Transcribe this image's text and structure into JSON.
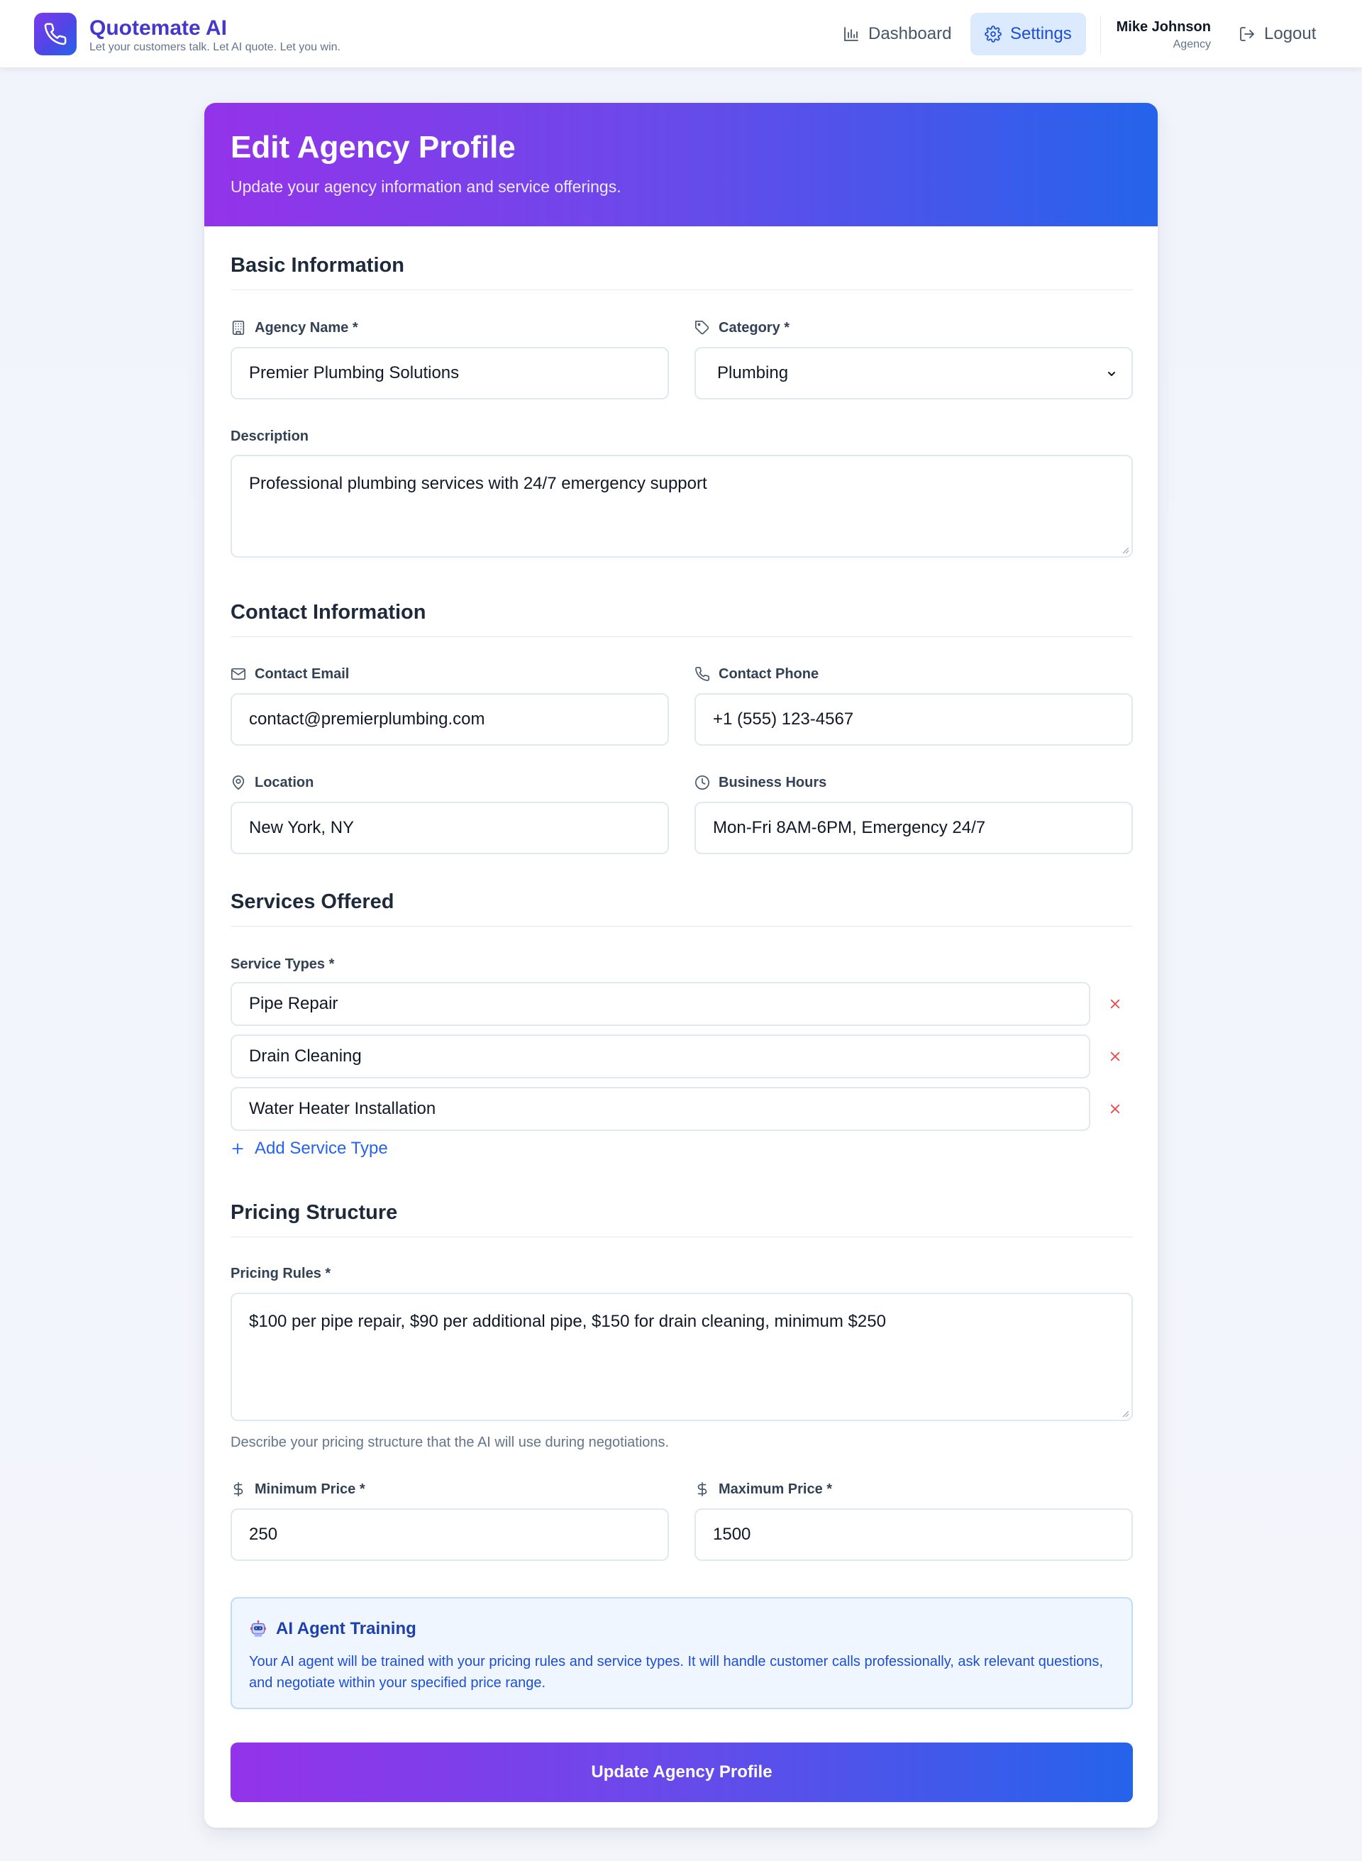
{
  "app": {
    "name": "Quotemate AI",
    "tagline": "Let your customers talk. Let AI quote. Let you win.",
    "brand_color": "#4338ca"
  },
  "nav": {
    "items": [
      {
        "label": "Dashboard",
        "icon": "bar-chart-icon",
        "active": false
      },
      {
        "label": "Settings",
        "icon": "gear-icon",
        "active": true
      }
    ],
    "user": {
      "name": "Mike Johnson",
      "role": "Agency"
    },
    "logout_label": "Logout"
  },
  "header": {
    "title": "Edit Agency Profile",
    "subtitle": "Update your agency information and service offerings."
  },
  "basic_info": {
    "title": "Basic Information",
    "agency_name": {
      "label": "Agency Name *",
      "value": "Premier Plumbing Solutions",
      "icon": "building-icon"
    },
    "category": {
      "label": "Category *",
      "value": "Plumbing",
      "icon": "tag-icon"
    },
    "description": {
      "label": "Description",
      "value": "Professional plumbing services with 24/7 emergency support"
    }
  },
  "contact_info": {
    "title": "Contact Information",
    "email": {
      "label": "Contact Email",
      "value": "contact@premierplumbing.com",
      "icon": "mail-icon"
    },
    "phone": {
      "label": "Contact Phone",
      "value": "+1 (555) 123-4567",
      "icon": "phone-icon"
    },
    "location": {
      "label": "Location",
      "value": "New York, NY",
      "icon": "map-pin-icon"
    },
    "hours": {
      "label": "Business Hours",
      "value": "Mon-Fri 8AM-6PM, Emergency 24/7",
      "icon": "clock-icon"
    }
  },
  "services": {
    "title": "Services Offered",
    "label": "Service Types *",
    "items": [
      "Pipe Repair",
      "Drain Cleaning",
      "Water Heater Installation"
    ],
    "add_label": "Add Service Type"
  },
  "pricing": {
    "title": "Pricing Structure",
    "rules_label": "Pricing Rules *",
    "rules_value": "$100 per pipe repair, $90 per additional pipe, $150 for drain cleaning, minimum $250",
    "helper": "Describe your pricing structure that the AI will use during negotiations.",
    "min": {
      "label": "Minimum Price *",
      "value": "250"
    },
    "max": {
      "label": "Maximum Price *",
      "value": "1500"
    }
  },
  "ai_training": {
    "title": "AI Agent Training",
    "body": "Your AI agent will be trained with your pricing rules and service types. It will handle customer calls professionally, ask relevant questions, and negotiate within your specified price range."
  },
  "submit_label": "Update Agency Profile",
  "colors": {
    "gradient_start": "#9333ea",
    "gradient_end": "#2563eb",
    "danger": "#ef4444",
    "link": "#2563eb"
  }
}
